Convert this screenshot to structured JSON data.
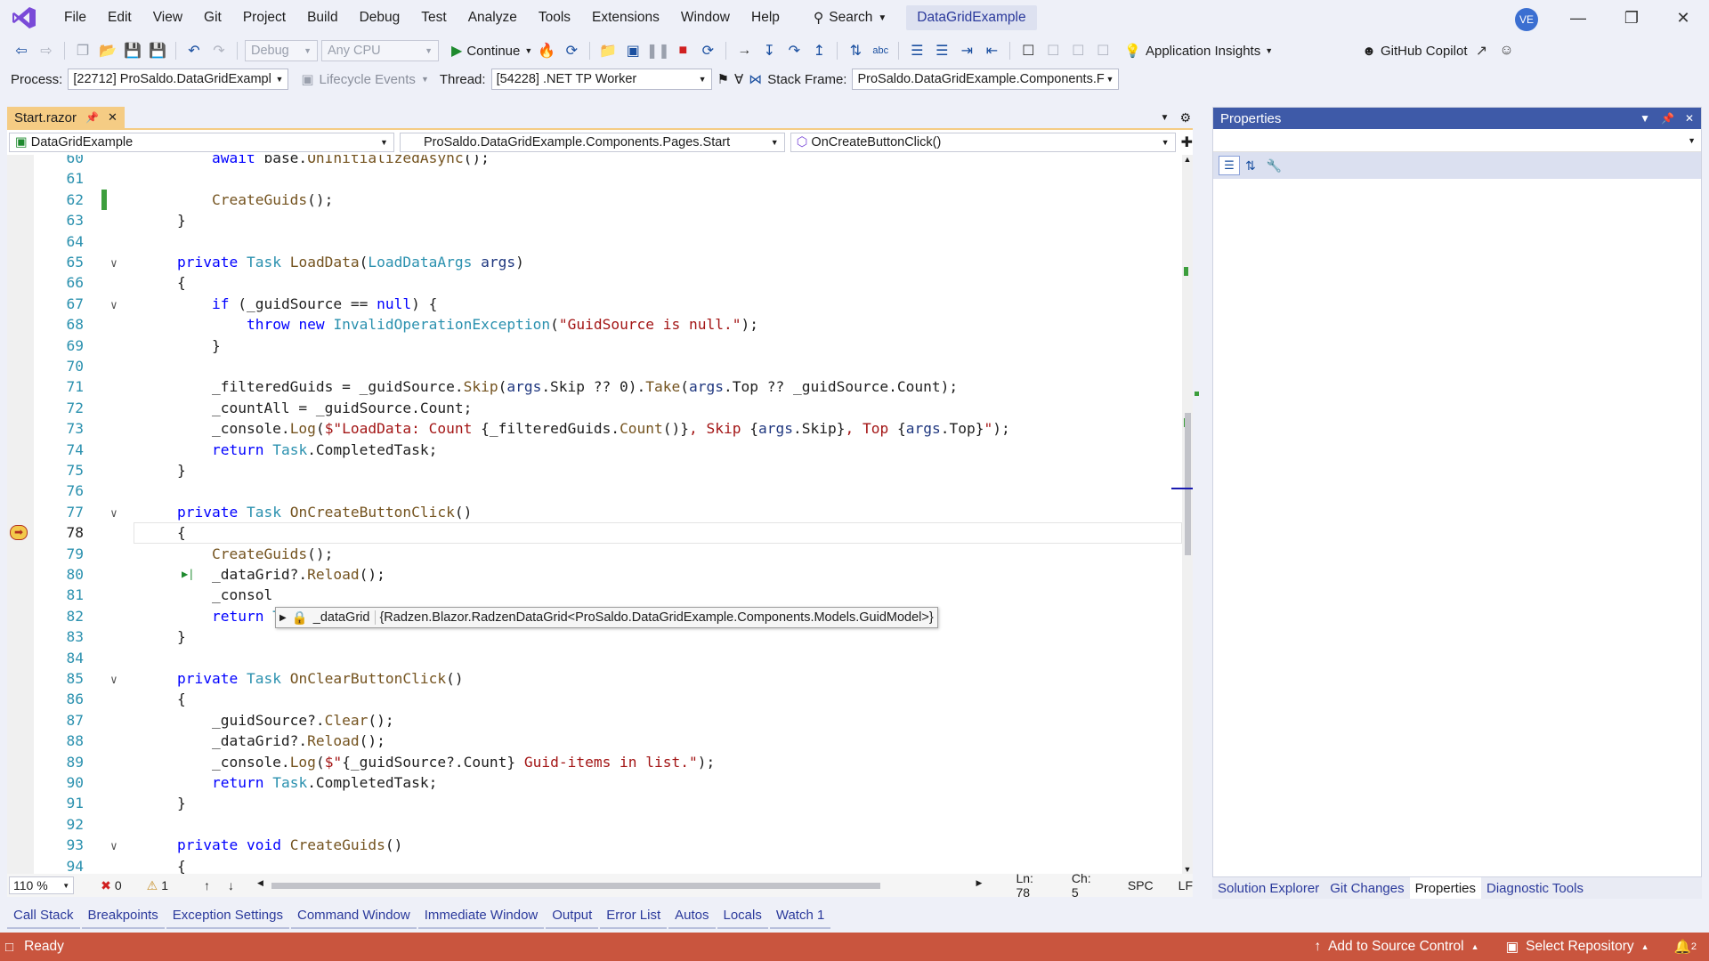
{
  "menu": {
    "items": [
      "File",
      "Edit",
      "View",
      "Git",
      "Project",
      "Build",
      "Debug",
      "Test",
      "Analyze",
      "Tools",
      "Extensions",
      "Window",
      "Help"
    ],
    "search_label": "Search",
    "solution_name": "DataGridExample",
    "user_initials": "VE"
  },
  "toolbar1": {
    "config": "Debug",
    "platform": "Any CPU",
    "continue_label": "Continue",
    "insights_label": "Application Insights",
    "copilot_label": "GitHub Copilot"
  },
  "toolbar2": {
    "process_label": "Process:",
    "process_value": "[22712] ProSaldo.DataGridExampl",
    "lifecycle_label": "Lifecycle Events",
    "thread_label": "Thread:",
    "thread_value": "[54228] .NET TP Worker",
    "stackframe_label": "Stack Frame:",
    "stackframe_value": "ProSaldo.DataGridExample.Components.F"
  },
  "editor": {
    "tab_name": "Start.razor",
    "nav_project": "DataGridExample",
    "nav_class": "ProSaldo.DataGridExample.Components.Pages.Start",
    "nav_member": "OnCreateButtonClick()",
    "datatip_name": "_dataGrid",
    "datatip_value": "{Radzen.Blazor.RadzenDataGrid<ProSaldo.DataGridExample.Components.Models.GuidModel>}",
    "lines": [
      {
        "n": "60",
        "tokens": [
          [
            "",
            "        "
          ],
          [
            "kw",
            "await"
          ],
          [
            "",
            " base."
          ],
          [
            "mt",
            "OnInitializedAsync"
          ],
          [
            "",
            "();"
          ]
        ]
      },
      {
        "n": "61",
        "tokens": []
      },
      {
        "n": "62",
        "tokens": [
          [
            "",
            "        "
          ],
          [
            "mt",
            "CreateGuids"
          ],
          [
            "",
            "();"
          ]
        ]
      },
      {
        "n": "63",
        "tokens": [
          [
            "",
            "    }"
          ]
        ]
      },
      {
        "n": "64",
        "tokens": []
      },
      {
        "n": "65",
        "tokens": [
          [
            "",
            "    "
          ],
          [
            "kw",
            "private"
          ],
          [
            "",
            " "
          ],
          [
            "ty",
            "Task"
          ],
          [
            "",
            " "
          ],
          [
            "mt",
            "LoadData"
          ],
          [
            "",
            "("
          ],
          [
            "ty",
            "LoadDataArgs"
          ],
          [
            "",
            " "
          ],
          [
            "pm",
            "args"
          ],
          [
            "",
            ")"
          ]
        ]
      },
      {
        "n": "66",
        "tokens": [
          [
            "",
            "    {"
          ]
        ]
      },
      {
        "n": "67",
        "tokens": [
          [
            "",
            "        "
          ],
          [
            "kw",
            "if"
          ],
          [
            "",
            " (_guidSource == "
          ],
          [
            "kw",
            "null"
          ],
          [
            "",
            ") {"
          ]
        ]
      },
      {
        "n": "68",
        "tokens": [
          [
            "",
            "            "
          ],
          [
            "kw",
            "throw"
          ],
          [
            "",
            " "
          ],
          [
            "kw",
            "new"
          ],
          [
            "",
            " "
          ],
          [
            "ty",
            "InvalidOperationException"
          ],
          [
            "",
            "("
          ],
          [
            "str",
            "\"GuidSource is null.\""
          ],
          [
            "",
            ");"
          ]
        ]
      },
      {
        "n": "69",
        "tokens": [
          [
            "",
            "        }"
          ]
        ]
      },
      {
        "n": "70",
        "tokens": []
      },
      {
        "n": "71",
        "tokens": [
          [
            "",
            "        _filteredGuids = _guidSource."
          ],
          [
            "mt",
            "Skip"
          ],
          [
            "",
            "("
          ],
          [
            "pm",
            "args"
          ],
          [
            "",
            ".Skip ?? 0)."
          ],
          [
            "mt",
            "Take"
          ],
          [
            "",
            "("
          ],
          [
            "pm",
            "args"
          ],
          [
            "",
            ".Top ?? _guidSource.Count);"
          ]
        ]
      },
      {
        "n": "72",
        "tokens": [
          [
            "",
            "        _countAll = _guidSource.Count;"
          ]
        ]
      },
      {
        "n": "73",
        "tokens": [
          [
            "",
            "        _console."
          ],
          [
            "mt",
            "Log"
          ],
          [
            "",
            "("
          ],
          [
            "str",
            "$\"LoadData: Count "
          ],
          [
            "",
            "{_filteredGuids."
          ],
          [
            "mt",
            "Count"
          ],
          [
            "",
            "()}"
          ],
          [
            "str",
            ", Skip "
          ],
          [
            "",
            "{"
          ],
          [
            "pm",
            "args"
          ],
          [
            "",
            ".Skip}"
          ],
          [
            "str",
            ", Top "
          ],
          [
            "",
            "{"
          ],
          [
            "pm",
            "args"
          ],
          [
            "",
            ".Top}"
          ],
          [
            "str",
            "\""
          ],
          [
            "",
            ");"
          ]
        ]
      },
      {
        "n": "74",
        "tokens": [
          [
            "",
            "        "
          ],
          [
            "kw",
            "return"
          ],
          [
            "",
            " "
          ],
          [
            "ty",
            "Task"
          ],
          [
            "",
            ".CompletedTask;"
          ]
        ]
      },
      {
        "n": "75",
        "tokens": [
          [
            "",
            "    }"
          ]
        ]
      },
      {
        "n": "76",
        "tokens": []
      },
      {
        "n": "77",
        "tokens": [
          [
            "",
            "    "
          ],
          [
            "kw",
            "private"
          ],
          [
            "",
            " "
          ],
          [
            "ty",
            "Task"
          ],
          [
            "",
            " "
          ],
          [
            "mt",
            "OnCreateButtonClick"
          ],
          [
            "",
            "()"
          ]
        ]
      },
      {
        "n": "78",
        "tokens": [
          [
            "",
            "    {"
          ]
        ]
      },
      {
        "n": "79",
        "tokens": [
          [
            "",
            "        "
          ],
          [
            "mt",
            "CreateGuids"
          ],
          [
            "",
            "();"
          ]
        ]
      },
      {
        "n": "80",
        "tokens": [
          [
            "",
            "        _dataGrid?."
          ],
          [
            "mt",
            "Reload"
          ],
          [
            "",
            "();"
          ]
        ]
      },
      {
        "n": "81",
        "tokens": [
          [
            "",
            "        _consol"
          ]
        ]
      },
      {
        "n": "82",
        "tokens": [
          [
            "",
            "        "
          ],
          [
            "kw",
            "return"
          ],
          [
            "",
            " "
          ],
          [
            "ty",
            "Task"
          ],
          [
            "",
            ".CompletedTask;"
          ]
        ]
      },
      {
        "n": "83",
        "tokens": [
          [
            "",
            "    }"
          ]
        ]
      },
      {
        "n": "84",
        "tokens": []
      },
      {
        "n": "85",
        "tokens": [
          [
            "",
            "    "
          ],
          [
            "kw",
            "private"
          ],
          [
            "",
            " "
          ],
          [
            "ty",
            "Task"
          ],
          [
            "",
            " "
          ],
          [
            "mt",
            "OnClearButtonClick"
          ],
          [
            "",
            "()"
          ]
        ]
      },
      {
        "n": "86",
        "tokens": [
          [
            "",
            "    {"
          ]
        ]
      },
      {
        "n": "87",
        "tokens": [
          [
            "",
            "        _guidSource?."
          ],
          [
            "mt",
            "Clear"
          ],
          [
            "",
            "();"
          ]
        ]
      },
      {
        "n": "88",
        "tokens": [
          [
            "",
            "        _dataGrid?."
          ],
          [
            "mt",
            "Reload"
          ],
          [
            "",
            "();"
          ]
        ]
      },
      {
        "n": "89",
        "tokens": [
          [
            "",
            "        _console."
          ],
          [
            "mt",
            "Log"
          ],
          [
            "",
            "("
          ],
          [
            "str",
            "$\""
          ],
          [
            "",
            "{_guidSource?.Count}"
          ],
          [
            "str",
            " Guid-items in list.\""
          ],
          [
            "",
            ");"
          ]
        ]
      },
      {
        "n": "90",
        "tokens": [
          [
            "",
            "        "
          ],
          [
            "kw",
            "return"
          ],
          [
            "",
            " "
          ],
          [
            "ty",
            "Task"
          ],
          [
            "",
            ".CompletedTask;"
          ]
        ]
      },
      {
        "n": "91",
        "tokens": [
          [
            "",
            "    }"
          ]
        ]
      },
      {
        "n": "92",
        "tokens": []
      },
      {
        "n": "93",
        "tokens": [
          [
            "",
            "    "
          ],
          [
            "kw",
            "private"
          ],
          [
            "",
            " "
          ],
          [
            "kw",
            "void"
          ],
          [
            "",
            " "
          ],
          [
            "mt",
            "CreateGuids"
          ],
          [
            "",
            "()"
          ]
        ]
      },
      {
        "n": "94",
        "tokens": [
          [
            "",
            "    {"
          ]
        ]
      }
    ],
    "status": {
      "zoom": "110 %",
      "errors": "0",
      "warnings": "1",
      "line": "Ln: 78",
      "col": "Ch: 5",
      "spacing": "SPC",
      "eol": "LF"
    }
  },
  "properties": {
    "title": "Properties",
    "tabs": [
      "Solution Explorer",
      "Git Changes",
      "Properties",
      "Diagnostic Tools"
    ]
  },
  "tool_tabs": [
    "Call Stack",
    "Breakpoints",
    "Exception Settings",
    "Command Window",
    "Immediate Window",
    "Output",
    "Error List",
    "Autos",
    "Locals",
    "Watch 1"
  ],
  "statusbar": {
    "ready": "Ready",
    "source_control": "Add to Source Control",
    "repository": "Select Repository",
    "notifications": "2"
  },
  "colors": {
    "accent": "#3e5aa8",
    "statusbar": "#c9553e",
    "tab_active": "#f5cc84"
  }
}
